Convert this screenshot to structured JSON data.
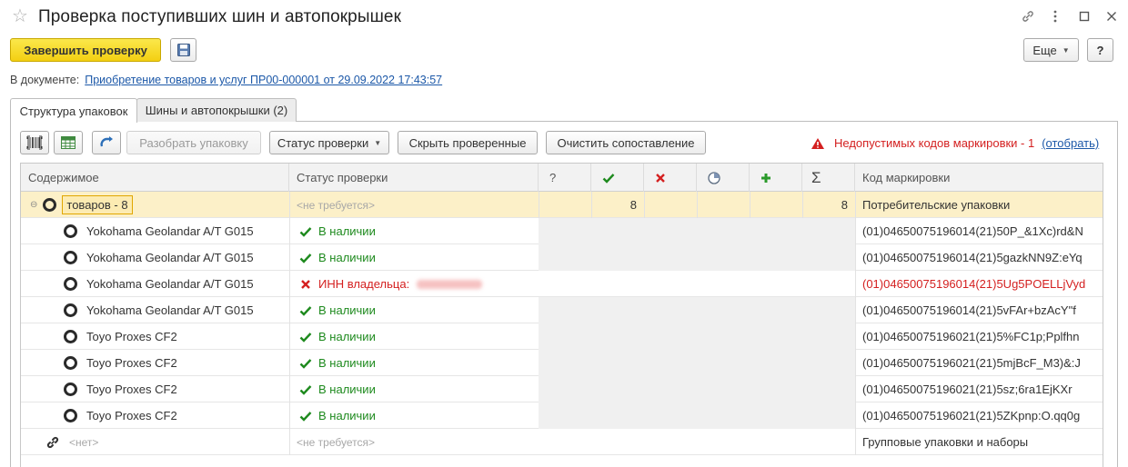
{
  "window": {
    "title": "Проверка поступивших шин и автопокрышек",
    "controls": [
      "link-icon",
      "more-icon",
      "maximize-icon",
      "close-icon"
    ]
  },
  "toolbar": {
    "finish_label": "Завершить проверку",
    "more_label": "Еще",
    "help_label": "?"
  },
  "document": {
    "prefix": "В документе:",
    "link": "Приобретение товаров и услуг ПР00-000001 от 29.09.2022 17:43:57"
  },
  "tabs": [
    {
      "label": "Структура упаковок",
      "active": true
    },
    {
      "label": "Шины и автопокрышки (2)",
      "active": false
    }
  ],
  "actions": {
    "unpack_label": "Разобрать упаковку",
    "status_label": "Статус проверки",
    "hide_label": "Скрыть проверенные",
    "clear_label": "Очистить сопоставление"
  },
  "warning": {
    "text": "Недопустимых кодов маркировки - 1",
    "link": "(отобрать)"
  },
  "table": {
    "headers": {
      "content": "Содержимое",
      "status": "Статус проверки",
      "unknown": "?",
      "sum": "Σ",
      "code": "Код маркировки"
    },
    "group_row": {
      "content": "товаров - 8",
      "status": "<не требуется>",
      "checked": "8",
      "total": "8",
      "code": "Потребительские упаковки"
    },
    "rows": [
      {
        "content": "Yokohama Geolandar A/T G015",
        "status": "В наличии",
        "code": "(01)04650075196014(21)50P_&1Xc)rd&N",
        "error": false
      },
      {
        "content": "Yokohama Geolandar A/T G015",
        "status": "В наличии",
        "code": "(01)04650075196014(21)5gazkNN9Z:eYq",
        "error": false
      },
      {
        "content": "Yokohama Geolandar A/T G015",
        "status": "ИНН владельца:",
        "code": "(01)04650075196014(21)5Ug5POELLjVyd",
        "error": true
      },
      {
        "content": "Yokohama Geolandar A/T G015",
        "status": "В наличии",
        "code": "(01)04650075196014(21)5vFAr+bzAcY\"f",
        "error": false
      },
      {
        "content": "Toyo Proxes CF2",
        "status": "В наличии",
        "code": "(01)04650075196021(21)5%FC1p;Pplfhn",
        "error": false
      },
      {
        "content": "Toyo Proxes CF2",
        "status": "В наличии",
        "code": "(01)04650075196021(21)5mjBcF_M3)&:J",
        "error": false
      },
      {
        "content": "Toyo Proxes CF2",
        "status": "В наличии",
        "code": "(01)04650075196021(21)5sz;6ra1EjKXr",
        "error": false
      },
      {
        "content": "Toyo Proxes CF2",
        "status": "В наличии",
        "code": "(01)04650075196021(21)5ZKpnp:O.qq0g",
        "error": false
      }
    ],
    "footer_row": {
      "content": "<нет>",
      "status": "<не требуется>",
      "code": "Групповые упаковки и наборы"
    }
  },
  "colors": {
    "primary_button": "#f5d21e",
    "link": "#1c58a8",
    "error": "#d42020",
    "ok": "#1e8a1e",
    "selected_row": "#fcf0c8"
  }
}
